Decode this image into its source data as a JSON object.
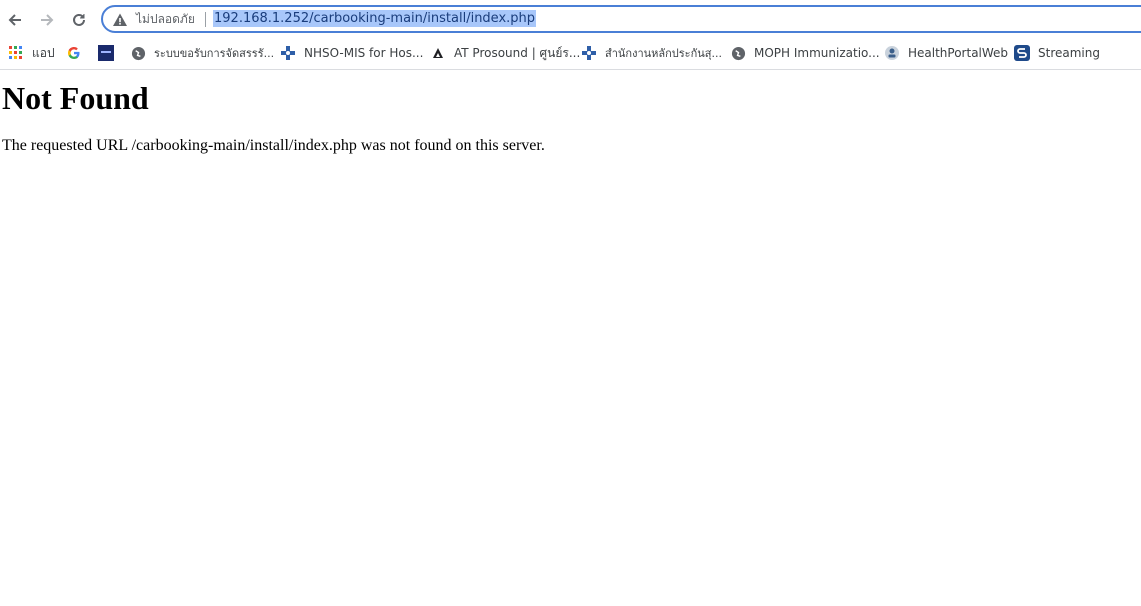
{
  "browser": {
    "security_label": "ไม่ปลอดภัย",
    "url": "192.168.1.252/carbooking-main/install/index.php"
  },
  "bookmarks": [
    {
      "label": "แอป",
      "icon": "apps-grid-icon"
    },
    {
      "label": "",
      "icon": "google-icon"
    },
    {
      "label": "",
      "icon": "site-logo-icon"
    },
    {
      "label": "ระบบขอรับการจัดสรรรั...",
      "icon": "globe-icon"
    },
    {
      "label": "NHSO-MIS for Hos...",
      "icon": "nhso-icon"
    },
    {
      "label": "AT Prosound | ศูนย์ร...",
      "icon": "triangle-logo-icon"
    },
    {
      "label": "สำนักงานหลักประกันสุ...",
      "icon": "nhso-icon"
    },
    {
      "label": "MOPH Immunizatio...",
      "icon": "globe-icon"
    },
    {
      "label": "HealthPortalWeb",
      "icon": "health-portal-icon"
    },
    {
      "label": "Streaming",
      "icon": "streaming-icon"
    }
  ],
  "page": {
    "title": "Not Found",
    "message": "The requested URL /carbooking-main/install/index.php was not found on this server."
  },
  "colors": {
    "accent": "#4a7fd6",
    "url_highlight": "#a8c7fa"
  }
}
